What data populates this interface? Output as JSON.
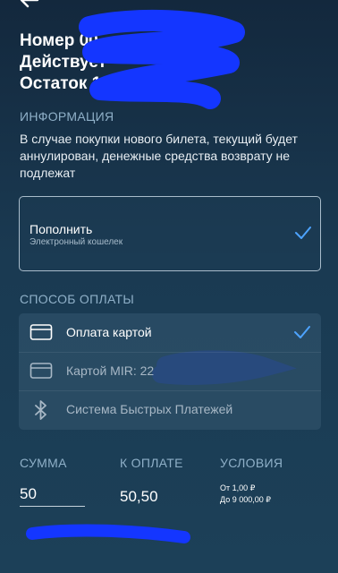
{
  "header": {
    "line1": "Номер 00",
    "line2": "Действует",
    "line3": "Остаток 10"
  },
  "info": {
    "title": "ИНФОРМАЦИЯ",
    "text": "В случае покупки нового билета, текущий будет аннулирован, денежные средства возврату не подлежат"
  },
  "topup": {
    "title": "Пополнить",
    "subtitle": "Электронный кошелек"
  },
  "payment": {
    "title": "СПОСОБ ОПЛАТЫ",
    "options": [
      {
        "label": "Оплата картой",
        "icon": "card-icon",
        "selected": true
      },
      {
        "label": "Картой MIR: 22",
        "icon": "card-icon",
        "selected": false
      },
      {
        "label": "Система Быстрых Платежей",
        "icon": "bluetooth-icon",
        "selected": false
      }
    ]
  },
  "summary": {
    "amount_label": "СУММА",
    "amount_value": "50",
    "to_pay_label": "К ОПЛАТЕ",
    "to_pay_value": "50,50",
    "conditions_label": "УСЛОВИЯ",
    "conditions_min": "От 1,00 ₽",
    "conditions_max": "До 9 000,00 ₽"
  },
  "colors": {
    "background": "#1a3a52",
    "accent": "#4da3ff",
    "redaction": "#1436ff"
  }
}
